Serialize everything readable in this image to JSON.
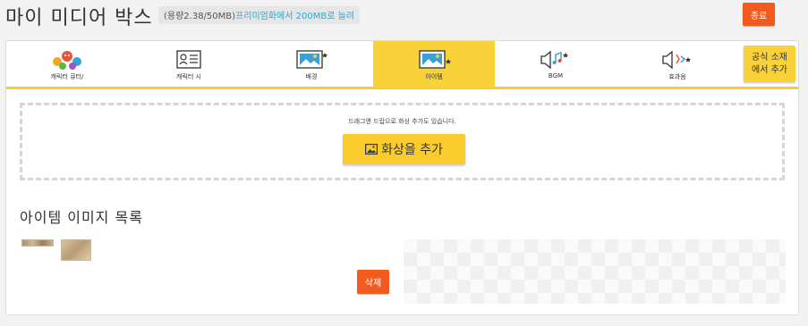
{
  "header": {
    "title": "마이 미디어 박스",
    "capacity_text": "(용량2.38/50MB)",
    "upgrade_link": "프리미엄화에서 200MB로 늘려",
    "close_label": "종료"
  },
  "tabs": [
    {
      "label": "캐릭터 큐터/",
      "icon": "characters-icon",
      "active": false
    },
    {
      "label": "캐릭터 시",
      "icon": "character-card-icon",
      "active": false
    },
    {
      "label": "배경",
      "icon": "background-image-icon",
      "active": false
    },
    {
      "label": "아이템",
      "icon": "item-image-icon",
      "active": true
    },
    {
      "label": "BGM",
      "icon": "music-speaker-icon",
      "active": false
    },
    {
      "label": "효과음",
      "icon": "sound-effect-icon",
      "active": false
    }
  ],
  "official_button": "공식 소재\n에서 추가",
  "dropzone": {
    "hint": "드래그앤 드랍으로 화상 추가도 있습니다.",
    "add_button": "화상을 추가"
  },
  "item_list": {
    "title": "아이템 이미지 목록",
    "delete_label": "삭제"
  },
  "colors": {
    "accent_yellow": "#f9d23a",
    "danger_orange": "#f25a1e",
    "link_blue": "#2fa7c9"
  }
}
